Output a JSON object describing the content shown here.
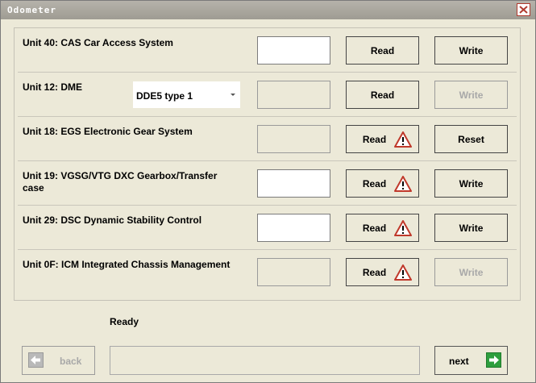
{
  "window": {
    "title": "Odometer"
  },
  "rows": [
    {
      "unit": "Unit 40: CAS Car Access System",
      "read_label": "Read",
      "action_label": "Write"
    },
    {
      "unit": "Unit 12: DME",
      "dropdown_value": "DDE5 type 1",
      "read_label": "Read",
      "action_label": "Write"
    },
    {
      "unit": "Unit 18: EGS Electronic Gear System",
      "read_label": "Read",
      "action_label": "Reset"
    },
    {
      "unit": "Unit 19: VGSG/VTG DXC Gearbox/Transfer case",
      "read_label": "Read",
      "action_label": "Write"
    },
    {
      "unit": "Unit 29: DSC Dynamic Stability Control",
      "read_label": "Read",
      "action_label": "Write"
    },
    {
      "unit": "Unit 0F: ICM Integrated Chassis Management",
      "read_label": "Read",
      "action_label": "Write"
    }
  ],
  "status": "Ready",
  "nav": {
    "back_label": "back",
    "next_label": "next"
  },
  "colors": {
    "background": "#ece9d8",
    "next_arrow": "#2e9e3e",
    "warning": "#c0392b"
  }
}
